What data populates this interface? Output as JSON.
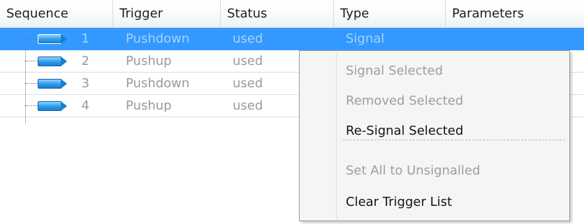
{
  "columns": {
    "sequence": "Sequence",
    "trigger": "Trigger",
    "status": "Status",
    "type": "Type",
    "parameters": "Parameters"
  },
  "rows": [
    {
      "seq": "1",
      "trigger": "Pushdown",
      "status": "used",
      "type": "Signal",
      "selected": true
    },
    {
      "seq": "2",
      "trigger": "Pushup",
      "status": "used",
      "type": "",
      "selected": false
    },
    {
      "seq": "3",
      "trigger": "Pushdown",
      "status": "used",
      "type": "",
      "selected": false
    },
    {
      "seq": "4",
      "trigger": "Pushup",
      "status": "used",
      "type": "",
      "selected": false
    }
  ],
  "row_icon": "blue-tag-icon",
  "context_menu": {
    "items": [
      {
        "label": "Signal Selected",
        "enabled": false
      },
      {
        "label": "Removed Selected",
        "enabled": false
      },
      {
        "label": "Re-Signal Selected",
        "enabled": true
      },
      {
        "label": "Set All to Unsignalled",
        "enabled": false
      },
      {
        "label": "Clear Trigger List",
        "enabled": true
      }
    ]
  },
  "colors": {
    "selection": "#3399ff",
    "header_border": "#d5dbe3",
    "menu_background": "#f5f5f5",
    "disabled_text": "#9e9e9e"
  }
}
